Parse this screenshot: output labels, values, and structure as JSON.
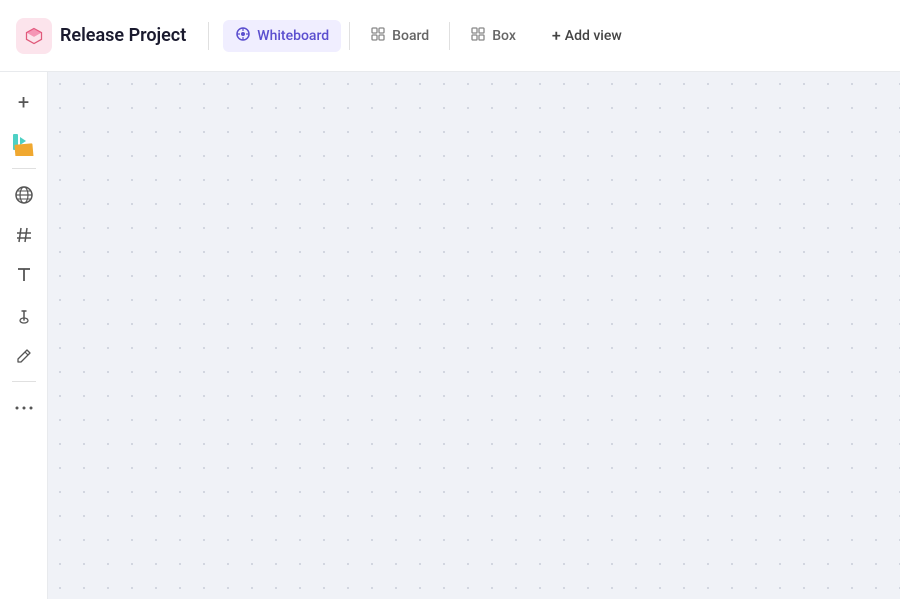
{
  "header": {
    "project_title": "Release Project",
    "tabs": [
      {
        "id": "whiteboard",
        "label": "Whiteboard",
        "active": true
      },
      {
        "id": "board",
        "label": "Board",
        "active": false
      },
      {
        "id": "box",
        "label": "Box",
        "active": false
      }
    ],
    "add_view_label": "Add view"
  },
  "sidebar": {
    "tools": [
      {
        "id": "add",
        "icon": "+",
        "label": "Add"
      },
      {
        "id": "sticky",
        "icon": "sticky",
        "label": "Sticky note"
      },
      {
        "id": "globe",
        "icon": "🌐",
        "label": "Globe"
      },
      {
        "id": "hash",
        "icon": "#",
        "label": "Hash"
      },
      {
        "id": "text",
        "icon": "T",
        "label": "Text"
      },
      {
        "id": "link",
        "icon": "🔗",
        "label": "Link"
      },
      {
        "id": "draw",
        "icon": "✏",
        "label": "Draw"
      },
      {
        "id": "more",
        "icon": "...",
        "label": "More"
      }
    ]
  },
  "canvas": {
    "background": "#f0f2f7"
  },
  "icons": {
    "whiteboard_icon": "○",
    "board_icon": "▦",
    "box_icon": "⊞",
    "plus": "+"
  }
}
